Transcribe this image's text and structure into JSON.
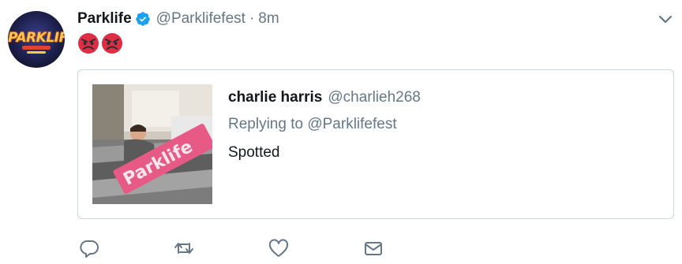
{
  "tweet": {
    "avatar_icon": "parklife-logo-avatar",
    "avatar_text": "PARKLIFE",
    "display_name": "Parklife",
    "verified_icon": "verified-badge-icon",
    "handle": "@Parklifefest",
    "separator": "·",
    "time": "8m",
    "menu_icon": "chevron-down-icon",
    "emojis": [
      "pouting-face-emoji",
      "pouting-face-emoji"
    ]
  },
  "quoted": {
    "name": "charlie harris",
    "handle": "@charlieh268",
    "replying_prefix": "Replying to",
    "replying_handle": "@Parklifefest",
    "text": "Spotted",
    "photo_icon": "photo-person-with-parklife-sign"
  },
  "actions": {
    "reply_icon": "reply-icon",
    "retweet_icon": "retweet-icon",
    "like_icon": "heart-icon",
    "dm_icon": "envelope-icon"
  },
  "colors": {
    "primary_text": "#14171a",
    "secondary_text": "#657786",
    "border": "#ccd6dd",
    "verified_blue": "#1da1f2",
    "icon_grey": "#657786"
  }
}
